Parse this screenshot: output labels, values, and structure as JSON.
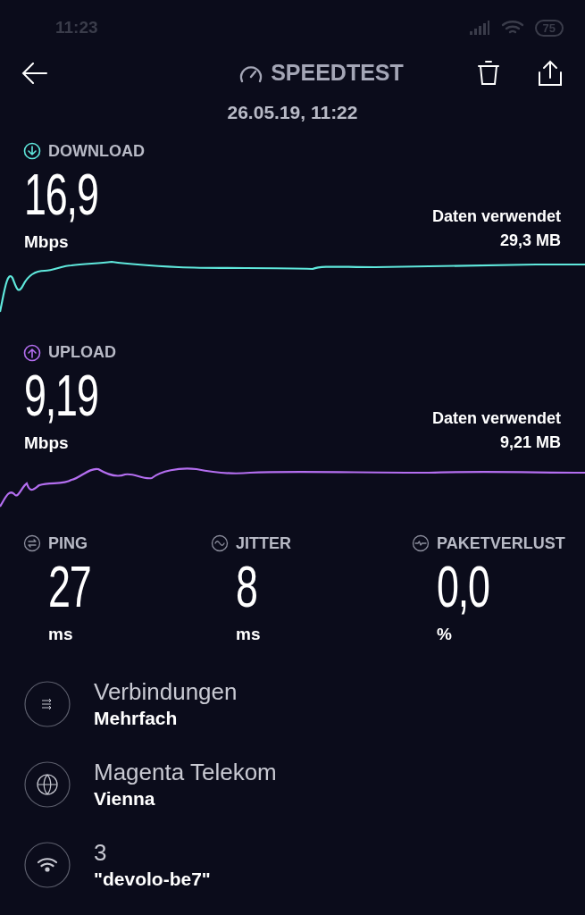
{
  "status_bar": {
    "time": "11:23",
    "battery": "75"
  },
  "header": {
    "title": "SPEEDTEST",
    "date": "26.05.19, 11:22"
  },
  "tests": [
    {
      "kind": "download",
      "label": "DOWNLOAD",
      "value": "16,9",
      "unit": "Mbps",
      "data_label": "Daten verwendet",
      "data_value": "29,3 MB",
      "color": "#5fe8dc"
    },
    {
      "kind": "upload",
      "label": "UPLOAD",
      "value": "9,19",
      "unit": "Mbps",
      "data_label": "Daten verwendet",
      "data_value": "9,21 MB",
      "color": "#b46ef0"
    }
  ],
  "stats": [
    {
      "kind": "ping",
      "label": "PING",
      "value": "27",
      "unit": "ms"
    },
    {
      "kind": "jitter",
      "label": "JITTER",
      "value": "8",
      "unit": "ms"
    },
    {
      "kind": "packet_loss",
      "label": "PAKETVERLUST",
      "value": "0,0",
      "unit": "%"
    }
  ],
  "info": [
    {
      "kind": "connections",
      "title": "Verbindungen",
      "value": "Mehrfach"
    },
    {
      "kind": "server",
      "title": "Magenta Telekom",
      "value": "Vienna"
    },
    {
      "kind": "network",
      "title": "3",
      "value": "\"devolo-be7\""
    }
  ]
}
